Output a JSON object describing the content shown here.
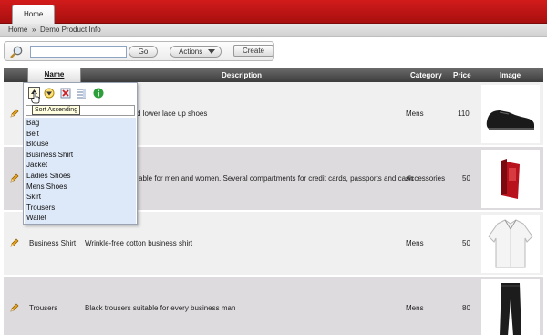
{
  "nav": {
    "tab_home": "Home"
  },
  "breadcrumb": {
    "home": "Home",
    "separator": "»",
    "current": "Demo Product Info"
  },
  "toolbar": {
    "search_value": "",
    "go_label": "Go",
    "actions_label": "Actions",
    "create_label": "Create"
  },
  "table": {
    "headers": {
      "name": "Name",
      "description": "Description",
      "category": "Category",
      "price": "Price",
      "image": "Image"
    },
    "rows": [
      {
        "name": "",
        "description": "d lower lace up shoes",
        "category": "Mens",
        "price": "110"
      },
      {
        "name": "",
        "description": "",
        "category": "Accessories",
        "price": "50"
      },
      {
        "name": "Business Shirt",
        "description": "Wrinkle-free cotton business shirt",
        "category": "Mens",
        "price": "50"
      },
      {
        "name": "Trousers",
        "description": "Black trousers suitable for every business man",
        "category": "Mens",
        "price": "80"
      }
    ],
    "row2_description_visible": "able for men and women. Several compartments for credit cards, passports and cash"
  },
  "column_menu": {
    "tooltip": "Sort Ascending",
    "filter_value": "",
    "values": [
      "Bag",
      "Belt",
      "Blouse",
      "Business Shirt",
      "Jacket",
      "Ladies Shoes",
      "Mens Shoes",
      "Skirt",
      "Trousers",
      "Wallet"
    ]
  },
  "colors": {
    "brand_red": "#c21414",
    "header_dark": "#4a4a4a",
    "row_odd": "#f0f0f0",
    "row_even": "#dedbde",
    "menu_list": "#dde8f8"
  }
}
